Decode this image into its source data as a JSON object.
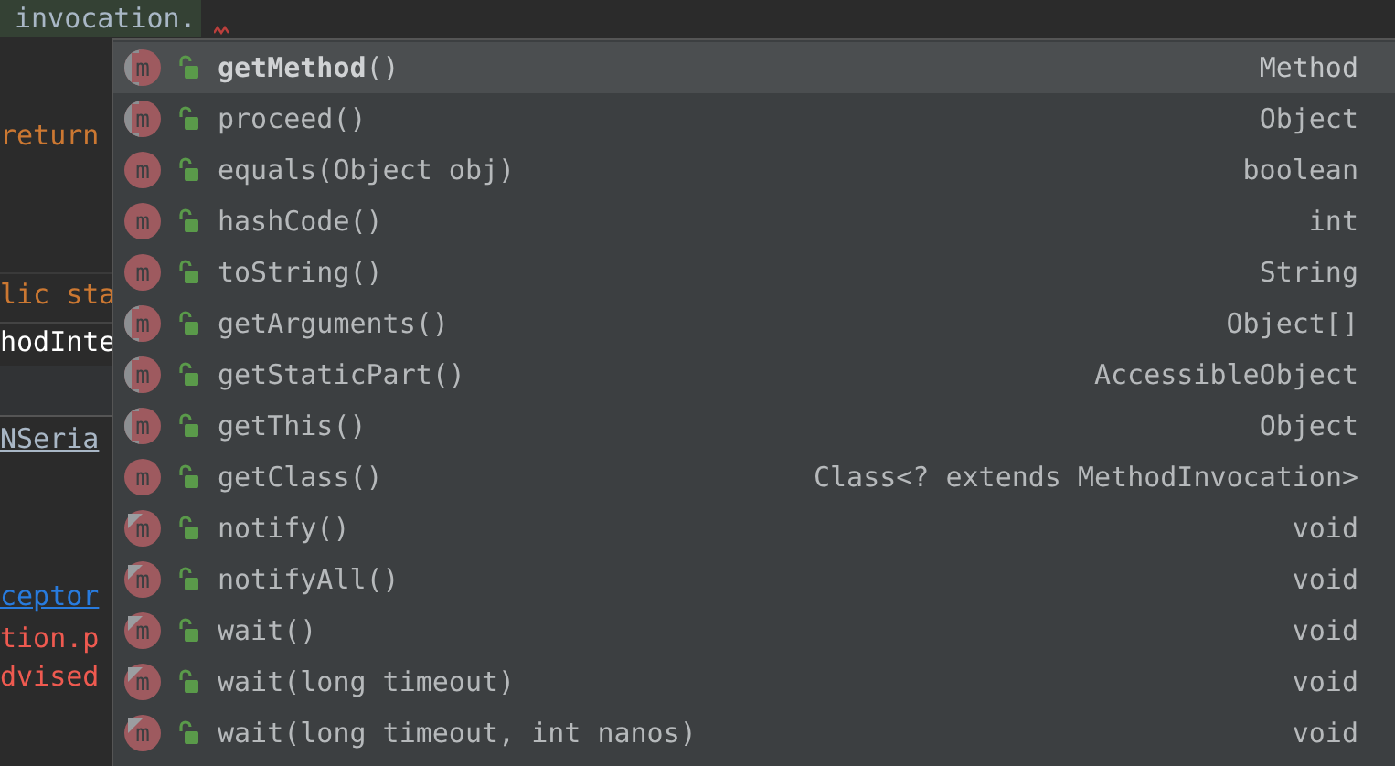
{
  "editor": {
    "lines": [
      {
        "text": "invocation.",
        "kind": "current"
      },
      {
        "text": "return",
        "kind": "keyword"
      },
      {
        "text": "lic sta",
        "kind": "keyword"
      },
      {
        "text": "hodInte",
        "kind": "plain"
      },
      {
        "text": "NSeria",
        "kind": "underlined"
      },
      {
        "text": "ceptor",
        "kind": "link"
      },
      {
        "text": "tion.p",
        "kind": "error"
      },
      {
        "text": "dvised",
        "kind": "error"
      }
    ]
  },
  "completion": {
    "items": [
      {
        "icon": "m",
        "signature": "**getMethod**()",
        "type": "Method",
        "selected": true,
        "kind": "abstract"
      },
      {
        "icon": "m",
        "signature": "proceed()",
        "type": "Object",
        "selected": false,
        "kind": "abstract"
      },
      {
        "icon": "m",
        "signature": "equals(Object obj)",
        "type": "boolean",
        "selected": false,
        "kind": "plain"
      },
      {
        "icon": "m",
        "signature": "hashCode()",
        "type": "int",
        "selected": false,
        "kind": "plain"
      },
      {
        "icon": "m",
        "signature": "toString()",
        "type": "String",
        "selected": false,
        "kind": "plain"
      },
      {
        "icon": "m",
        "signature": "getArguments()",
        "type": "Object[]",
        "selected": false,
        "kind": "abstract"
      },
      {
        "icon": "m",
        "signature": "getStaticPart()",
        "type": "AccessibleObject",
        "selected": false,
        "kind": "abstract"
      },
      {
        "icon": "m",
        "signature": "getThis()",
        "type": "Object",
        "selected": false,
        "kind": "abstract"
      },
      {
        "icon": "m",
        "signature": "getClass()",
        "type": "Class<? extends MethodInvocation>",
        "selected": false,
        "kind": "plain"
      },
      {
        "icon": "m",
        "signature": "notify()",
        "type": "void",
        "selected": false,
        "kind": "final"
      },
      {
        "icon": "m",
        "signature": "notifyAll()",
        "type": "void",
        "selected": false,
        "kind": "final"
      },
      {
        "icon": "m",
        "signature": "wait()",
        "type": "void",
        "selected": false,
        "kind": "final"
      },
      {
        "icon": "m",
        "signature": "wait(long timeout)",
        "type": "void",
        "selected": false,
        "kind": "final"
      },
      {
        "icon": "m",
        "signature": "wait(long timeout, int nanos)",
        "type": "void",
        "selected": false,
        "kind": "final"
      }
    ]
  }
}
